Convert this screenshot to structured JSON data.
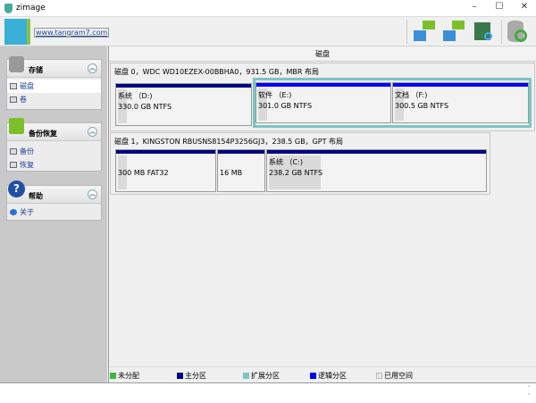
{
  "window": {
    "title": "zimage",
    "minimize": "–",
    "maximize": "☐",
    "close": "✕"
  },
  "toolbar": {
    "link": "www.tangram7.com",
    "buttons": [
      "backup-icon",
      "restore-icon",
      "browse-image-icon",
      "refresh-icon"
    ]
  },
  "sidebar": {
    "groups": [
      {
        "title": "存储",
        "items": [
          {
            "label": "磁盘",
            "selected": true
          },
          {
            "label": "卷"
          }
        ]
      },
      {
        "title": "备份恢复",
        "items": [
          {
            "label": "备份"
          },
          {
            "label": "恢复"
          }
        ]
      },
      {
        "title": "帮助",
        "items": [
          {
            "label": "关于"
          }
        ]
      }
    ]
  },
  "main": {
    "header": "磁盘",
    "disks": [
      {
        "label": "磁盘 0，WDC WD10EZEX-00BBHA0，931.5 GB，MBR 布局",
        "partitions": [
          {
            "name": "系统 （D:)",
            "size": "330.0 GB NTFS"
          },
          {
            "name": "软件 （E:)",
            "size": "301.0 GB NTFS"
          },
          {
            "name": "文档 （F:)",
            "size": "300.5 GB NTFS"
          }
        ]
      },
      {
        "label": "磁盘 1，KINGSTON RBUSNS8154P3256GJ3，238.5 GB，GPT 布局",
        "partitions": [
          {
            "name": "",
            "size": "300 MB FAT32"
          },
          {
            "name": "",
            "size": "16 MB"
          },
          {
            "name": "系统 （C:)",
            "size": "238.2 GB NTFS"
          }
        ]
      }
    ],
    "legend": [
      {
        "label": "未分配",
        "color": "#3cb83c"
      },
      {
        "label": "主分区",
        "color": "#000080"
      },
      {
        "label": "扩展分区",
        "color": "#7fc4c4"
      },
      {
        "label": "逻辑分区",
        "color": "#0000ff"
      },
      {
        "label": "已用空间",
        "color": "#e8e8e8"
      }
    ]
  }
}
